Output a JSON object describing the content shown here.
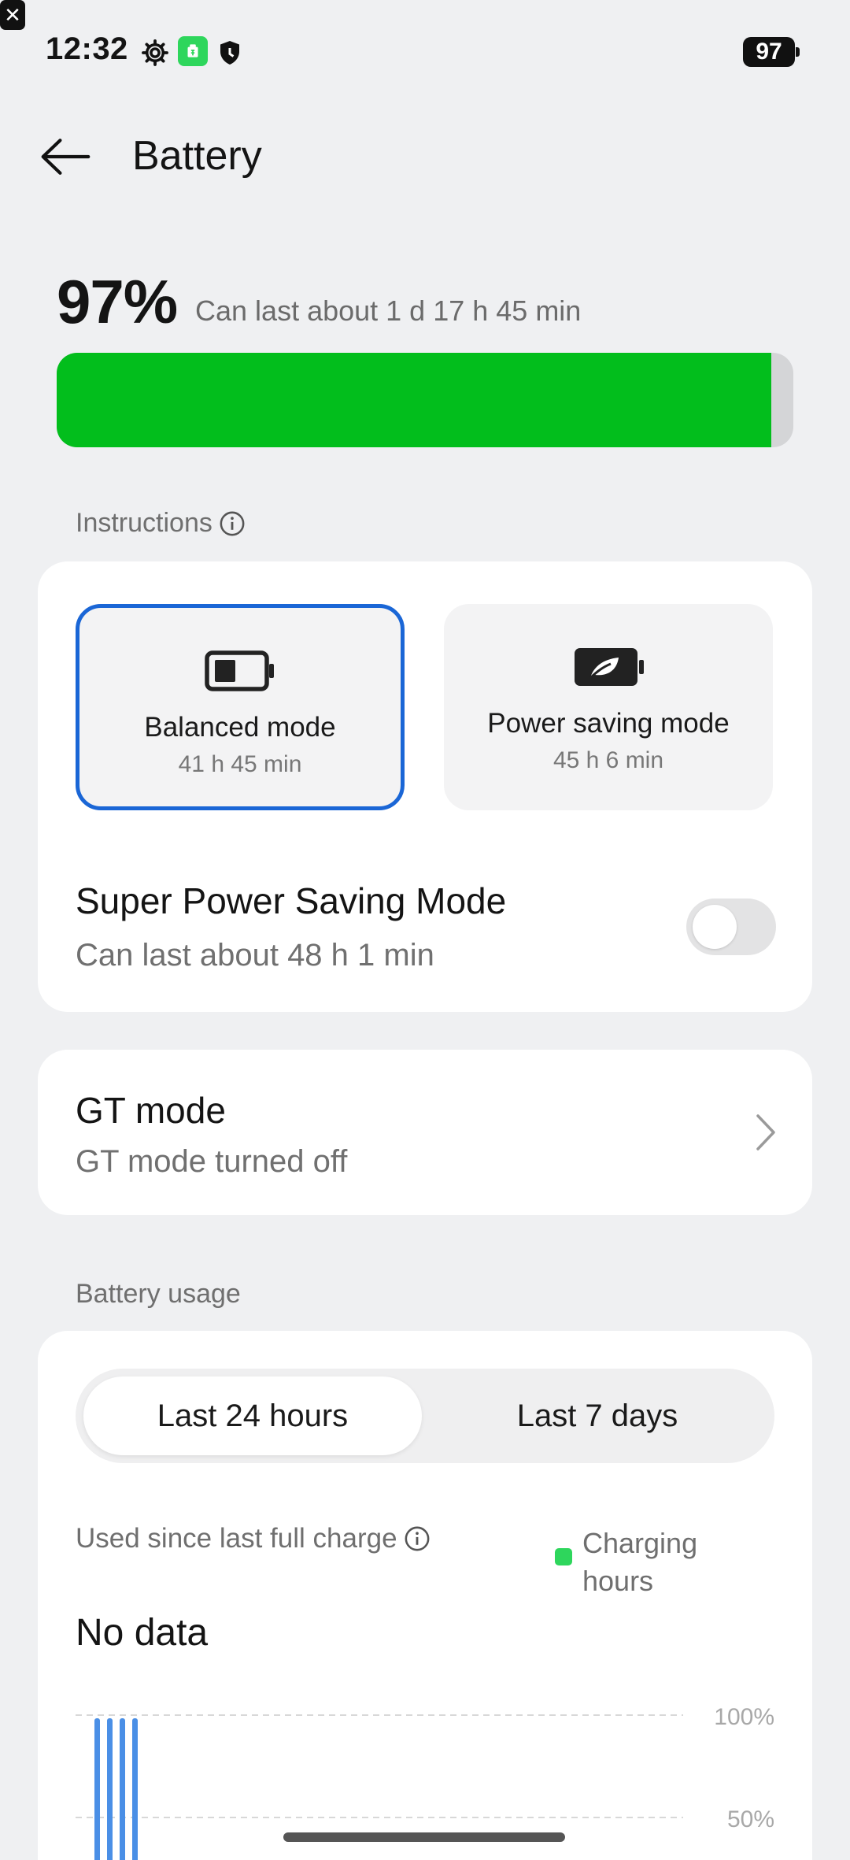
{
  "status_bar": {
    "time": "12:32",
    "icons": [
      "gear-icon",
      "app-icon",
      "shield-icon",
      "close-box-icon"
    ],
    "battery_level": "97"
  },
  "header": {
    "title": "Battery",
    "back_icon": "arrow-left-icon"
  },
  "summary": {
    "percent": "97%",
    "estimate": "Can last about 1 d 17 h 45 min",
    "level_fraction": 0.97,
    "fill_color": "#02be1c"
  },
  "modes_section": {
    "label": "Instructions",
    "modes": [
      {
        "name": "Balanced mode",
        "time": "41 h 45 min",
        "selected": true,
        "icon": "battery-icon"
      },
      {
        "name": "Power saving mode",
        "time": "45 h 6 min",
        "selected": false,
        "icon": "battery-leaf-icon"
      }
    ],
    "super_saving": {
      "title": "Super Power Saving Mode",
      "subtitle": "Can last about 48 h 1 min",
      "enabled": false
    }
  },
  "gt_mode": {
    "title": "GT mode",
    "subtitle": "GT mode turned off"
  },
  "usage": {
    "label": "Battery usage",
    "tabs": [
      "Last 24 hours",
      "Last 7 days"
    ],
    "active_tab": 0,
    "used_since_label": "Used since last full charge",
    "legend": "Charging hours",
    "legend_color": "#2ed65c",
    "no_data": "No data"
  },
  "chart_data": {
    "type": "bar",
    "y_ticks": [
      "100%",
      "50%"
    ],
    "ylim": [
      0,
      100
    ],
    "bar_color": "#4a8fe6",
    "bar_count_visible": 4,
    "grid": true
  }
}
